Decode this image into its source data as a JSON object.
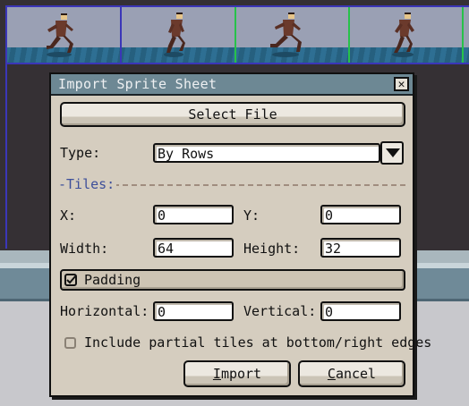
{
  "dialog": {
    "title": "Import Sprite Sheet",
    "close_glyph": "✕",
    "select_file_label": "Select File",
    "type_label": "Type:",
    "type_value": "By Rows",
    "tiles_section": "-Tiles:",
    "x_label": "X:",
    "x_value": "0",
    "y_label": "Y:",
    "y_value": "0",
    "width_label": "Width:",
    "width_value": "64",
    "height_label": "Height:",
    "height_value": "32",
    "padding_label": "Padding",
    "padding_checked": true,
    "horizontal_label": "Horizontal:",
    "horizontal_value": "0",
    "vertical_label": "Vertical:",
    "vertical_value": "0",
    "partial_tiles_label": "Include partial tiles at bottom/right edges",
    "partial_tiles_checked": false,
    "import_label": "Import",
    "cancel_label": "Cancel"
  },
  "icons": {
    "close": "close-icon",
    "dropdown": "chevron-down-icon",
    "check": "checkmark-icon"
  },
  "colors": {
    "titlebar": "#6d8894",
    "dialog_bg": "#d5cdbf",
    "tiles_section_text": "#3d4f9a",
    "grid_line": "#3b36b8",
    "frame_divider": "#27c24a",
    "canvas_bg": "#353034"
  }
}
